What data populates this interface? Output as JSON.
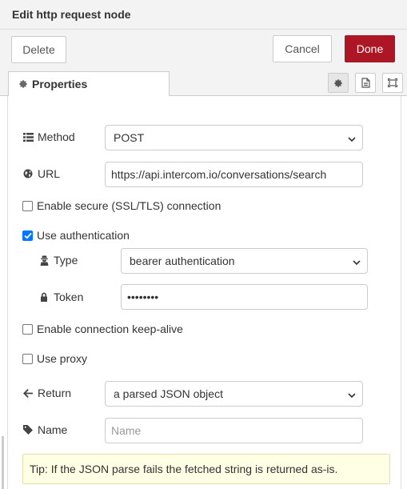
{
  "header": {
    "title": "Edit http request node"
  },
  "toolbar": {
    "delete_label": "Delete",
    "cancel_label": "Cancel",
    "done_label": "Done"
  },
  "tabs": {
    "properties_label": "Properties"
  },
  "form": {
    "method": {
      "label": "Method",
      "value": "POST"
    },
    "url": {
      "label": "URL",
      "value": "https://api.intercom.io/conversations/search"
    },
    "ssl": {
      "label": "Enable secure (SSL/TLS) connection",
      "checked": false
    },
    "auth": {
      "label": "Use authentication",
      "checked": true
    },
    "auth_type": {
      "label": "Type",
      "value": "bearer authentication"
    },
    "token": {
      "label": "Token",
      "value": "••••••••"
    },
    "keepalive": {
      "label": "Enable connection keep-alive",
      "checked": false
    },
    "proxy": {
      "label": "Use proxy",
      "checked": false
    },
    "return": {
      "label": "Return",
      "value": "a parsed JSON object"
    },
    "name": {
      "label": "Name",
      "placeholder": "Name"
    }
  },
  "tip": {
    "text": "Tip: If the JSON parse fails the fetched string is returned as-is."
  },
  "colors": {
    "accent": "#ad1625",
    "checkbox": "#0075ff",
    "tip_bg": "#ffffe6"
  },
  "icons": {
    "method": "list-icon",
    "url": "globe-icon",
    "type": "user-secret-icon",
    "token": "lock-icon",
    "return": "arrow-left-icon",
    "name": "tag-icon",
    "properties": "gear-icon"
  }
}
